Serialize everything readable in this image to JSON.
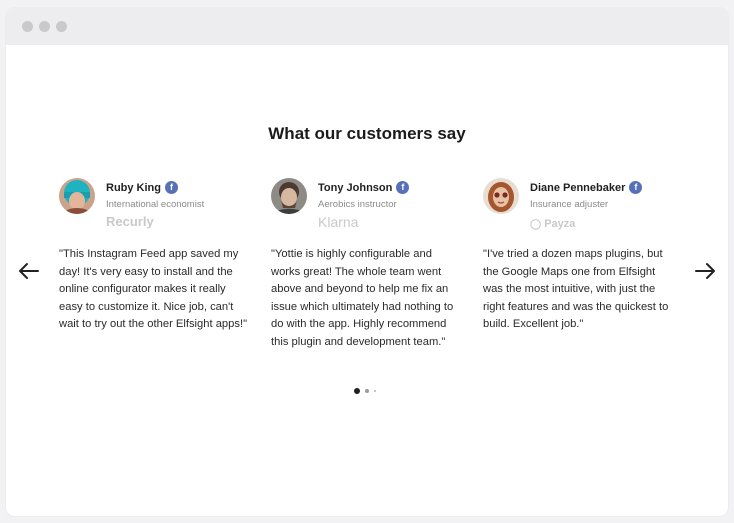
{
  "heading": "What our customers say",
  "testimonials": [
    {
      "name": "Ruby King",
      "role": "International economist",
      "company": "Recurly",
      "quote": "\"This Instagram Feed app saved my day! It's very easy to install and the online configurator makes it really easy to customize it. Nice job, can't wait to try out the other Elfsight apps!\""
    },
    {
      "name": "Tony Johnson",
      "role": "Aerobics instructor",
      "company": "Klarna",
      "quote": "\"Yottie is highly configurable and works great! The whole team went above and beyond to help me fix an issue which ultimately had nothing to do with the app. Highly recommend this plugin and development team.\""
    },
    {
      "name": "Diane Pennebaker",
      "role": "Insurance adjuster",
      "company": "Payza",
      "quote": "\"I've tried a dozen maps plugins, but the Google Maps one from Elfsight was the most intuitive, with just the right features and was the quickest to build. Excellent job.\""
    }
  ],
  "facebook_badge": "f",
  "pagination": {
    "pages": 3,
    "active": 1
  },
  "colors": {
    "facebook": "#5870b7",
    "text": "#2a2a2a",
    "muted": "#8a8a8a",
    "logo": "#c9c9c9"
  },
  "icons": {
    "prev": "arrow-left-icon",
    "next": "arrow-right-icon",
    "verified": "facebook-icon"
  }
}
